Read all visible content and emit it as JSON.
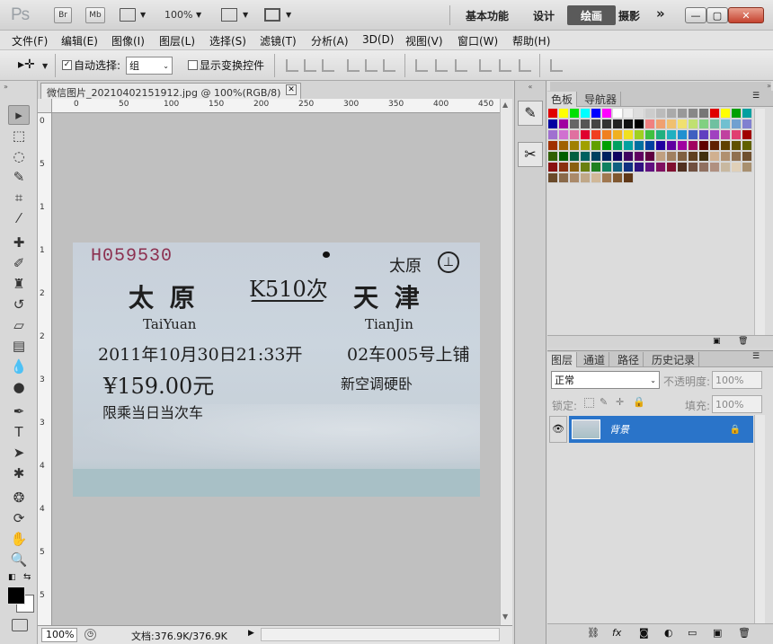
{
  "app": {
    "logo": "Ps",
    "bridge_btn": "Br",
    "mini_bridge_btn": "Mb",
    "zoom": "100%"
  },
  "workspaces": {
    "basic": "基本功能",
    "design": "设计",
    "painting": "绘画",
    "photography": "摄影",
    "more": "»"
  },
  "window_controls": {
    "minimize": "—",
    "maximize": "▢",
    "close": "✕"
  },
  "menu": [
    "文件(F)",
    "编辑(E)",
    "图像(I)",
    "图层(L)",
    "选择(S)",
    "滤镜(T)",
    "分析(A)",
    "3D(D)",
    "视图(V)",
    "窗口(W)",
    "帮助(H)"
  ],
  "options": {
    "auto_select_label": "自动选择:",
    "auto_select_value": "组",
    "show_transform": "显示变换控件"
  },
  "document": {
    "tab_title": "微信图片_20210402151912.jpg @ 100%(RGB/8)",
    "ruler_ticks": [
      "0",
      "50",
      "100",
      "150",
      "200",
      "250",
      "300",
      "350",
      "400",
      "450"
    ],
    "vruler_ticks": [
      "0",
      "5",
      "1",
      "1",
      "2",
      "2",
      "3",
      "3",
      "4",
      "4",
      "5",
      "5"
    ]
  },
  "ticket": {
    "serial": "H059530",
    "station_small": "太原",
    "origin": "太 原",
    "train": "K510次",
    "destination": "天 津",
    "origin_pinyin": "TaiYuan",
    "destination_pinyin": "TianJin",
    "datetime": "2011年10月30日21:33开",
    "seat": "02车005号上铺",
    "price": "¥159.00元",
    "class": "新空调硬卧",
    "note": "限乘当日当次车"
  },
  "status": {
    "zoom": "100%",
    "doc_size": "文档:376.9K/376.9K"
  },
  "panel_top": {
    "tabs": [
      "色板",
      "导航器"
    ]
  },
  "panel_layers": {
    "tabs": [
      "图层",
      "通道",
      "路径",
      "历史记录"
    ],
    "blend_mode": "正常",
    "opacity_label": "不透明度:",
    "opacity_value": "100%",
    "lock_label": "锁定:",
    "fill_label": "填充:",
    "fill_value": "100%",
    "layer_name": "背景"
  },
  "colors": {
    "selected_layer": "#2a74c9",
    "foreground": "#000000",
    "background": "#ffffff"
  }
}
